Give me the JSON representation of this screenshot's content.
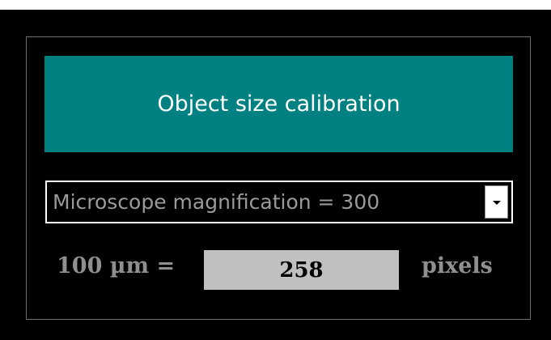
{
  "title": "Object size calibration",
  "magnification_select": {
    "selected": "Microscope magnification = 300"
  },
  "calibration": {
    "length_label": "100 µm =",
    "pixels_value": "258",
    "unit_label": "pixels"
  },
  "colors": {
    "title_bar": "#008080",
    "background": "#000000",
    "pixels_field": "#c0c0c0"
  }
}
